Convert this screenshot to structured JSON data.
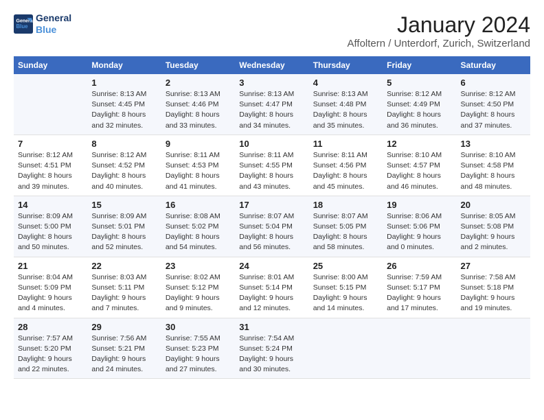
{
  "logo": {
    "line1": "General",
    "line2": "Blue"
  },
  "title": "January 2024",
  "subtitle": "Affoltern / Unterdorf, Zurich, Switzerland",
  "header_color": "#3a6abf",
  "days_of_week": [
    "Sunday",
    "Monday",
    "Tuesday",
    "Wednesday",
    "Thursday",
    "Friday",
    "Saturday"
  ],
  "weeks": [
    [
      {
        "day": "",
        "sunrise": "",
        "sunset": "",
        "daylight": ""
      },
      {
        "day": "1",
        "sunrise": "8:13 AM",
        "sunset": "4:45 PM",
        "daylight": "8 hours and 32 minutes."
      },
      {
        "day": "2",
        "sunrise": "8:13 AM",
        "sunset": "4:46 PM",
        "daylight": "8 hours and 33 minutes."
      },
      {
        "day": "3",
        "sunrise": "8:13 AM",
        "sunset": "4:47 PM",
        "daylight": "8 hours and 34 minutes."
      },
      {
        "day": "4",
        "sunrise": "8:13 AM",
        "sunset": "4:48 PM",
        "daylight": "8 hours and 35 minutes."
      },
      {
        "day": "5",
        "sunrise": "8:12 AM",
        "sunset": "4:49 PM",
        "daylight": "8 hours and 36 minutes."
      },
      {
        "day": "6",
        "sunrise": "8:12 AM",
        "sunset": "4:50 PM",
        "daylight": "8 hours and 37 minutes."
      }
    ],
    [
      {
        "day": "7",
        "sunrise": "8:12 AM",
        "sunset": "4:51 PM",
        "daylight": "8 hours and 39 minutes."
      },
      {
        "day": "8",
        "sunrise": "8:12 AM",
        "sunset": "4:52 PM",
        "daylight": "8 hours and 40 minutes."
      },
      {
        "day": "9",
        "sunrise": "8:11 AM",
        "sunset": "4:53 PM",
        "daylight": "8 hours and 41 minutes."
      },
      {
        "day": "10",
        "sunrise": "8:11 AM",
        "sunset": "4:55 PM",
        "daylight": "8 hours and 43 minutes."
      },
      {
        "day": "11",
        "sunrise": "8:11 AM",
        "sunset": "4:56 PM",
        "daylight": "8 hours and 45 minutes."
      },
      {
        "day": "12",
        "sunrise": "8:10 AM",
        "sunset": "4:57 PM",
        "daylight": "8 hours and 46 minutes."
      },
      {
        "day": "13",
        "sunrise": "8:10 AM",
        "sunset": "4:58 PM",
        "daylight": "8 hours and 48 minutes."
      }
    ],
    [
      {
        "day": "14",
        "sunrise": "8:09 AM",
        "sunset": "5:00 PM",
        "daylight": "8 hours and 50 minutes."
      },
      {
        "day": "15",
        "sunrise": "8:09 AM",
        "sunset": "5:01 PM",
        "daylight": "8 hours and 52 minutes."
      },
      {
        "day": "16",
        "sunrise": "8:08 AM",
        "sunset": "5:02 PM",
        "daylight": "8 hours and 54 minutes."
      },
      {
        "day": "17",
        "sunrise": "8:07 AM",
        "sunset": "5:04 PM",
        "daylight": "8 hours and 56 minutes."
      },
      {
        "day": "18",
        "sunrise": "8:07 AM",
        "sunset": "5:05 PM",
        "daylight": "8 hours and 58 minutes."
      },
      {
        "day": "19",
        "sunrise": "8:06 AM",
        "sunset": "5:06 PM",
        "daylight": "9 hours and 0 minutes."
      },
      {
        "day": "20",
        "sunrise": "8:05 AM",
        "sunset": "5:08 PM",
        "daylight": "9 hours and 2 minutes."
      }
    ],
    [
      {
        "day": "21",
        "sunrise": "8:04 AM",
        "sunset": "5:09 PM",
        "daylight": "9 hours and 4 minutes."
      },
      {
        "day": "22",
        "sunrise": "8:03 AM",
        "sunset": "5:11 PM",
        "daylight": "9 hours and 7 minutes."
      },
      {
        "day": "23",
        "sunrise": "8:02 AM",
        "sunset": "5:12 PM",
        "daylight": "9 hours and 9 minutes."
      },
      {
        "day": "24",
        "sunrise": "8:01 AM",
        "sunset": "5:14 PM",
        "daylight": "9 hours and 12 minutes."
      },
      {
        "day": "25",
        "sunrise": "8:00 AM",
        "sunset": "5:15 PM",
        "daylight": "9 hours and 14 minutes."
      },
      {
        "day": "26",
        "sunrise": "7:59 AM",
        "sunset": "5:17 PM",
        "daylight": "9 hours and 17 minutes."
      },
      {
        "day": "27",
        "sunrise": "7:58 AM",
        "sunset": "5:18 PM",
        "daylight": "9 hours and 19 minutes."
      }
    ],
    [
      {
        "day": "28",
        "sunrise": "7:57 AM",
        "sunset": "5:20 PM",
        "daylight": "9 hours and 22 minutes."
      },
      {
        "day": "29",
        "sunrise": "7:56 AM",
        "sunset": "5:21 PM",
        "daylight": "9 hours and 24 minutes."
      },
      {
        "day": "30",
        "sunrise": "7:55 AM",
        "sunset": "5:23 PM",
        "daylight": "9 hours and 27 minutes."
      },
      {
        "day": "31",
        "sunrise": "7:54 AM",
        "sunset": "5:24 PM",
        "daylight": "9 hours and 30 minutes."
      },
      {
        "day": "",
        "sunrise": "",
        "sunset": "",
        "daylight": ""
      },
      {
        "day": "",
        "sunrise": "",
        "sunset": "",
        "daylight": ""
      },
      {
        "day": "",
        "sunrise": "",
        "sunset": "",
        "daylight": ""
      }
    ]
  ],
  "labels": {
    "sunrise": "Sunrise:",
    "sunset": "Sunset:",
    "daylight": "Daylight:"
  }
}
